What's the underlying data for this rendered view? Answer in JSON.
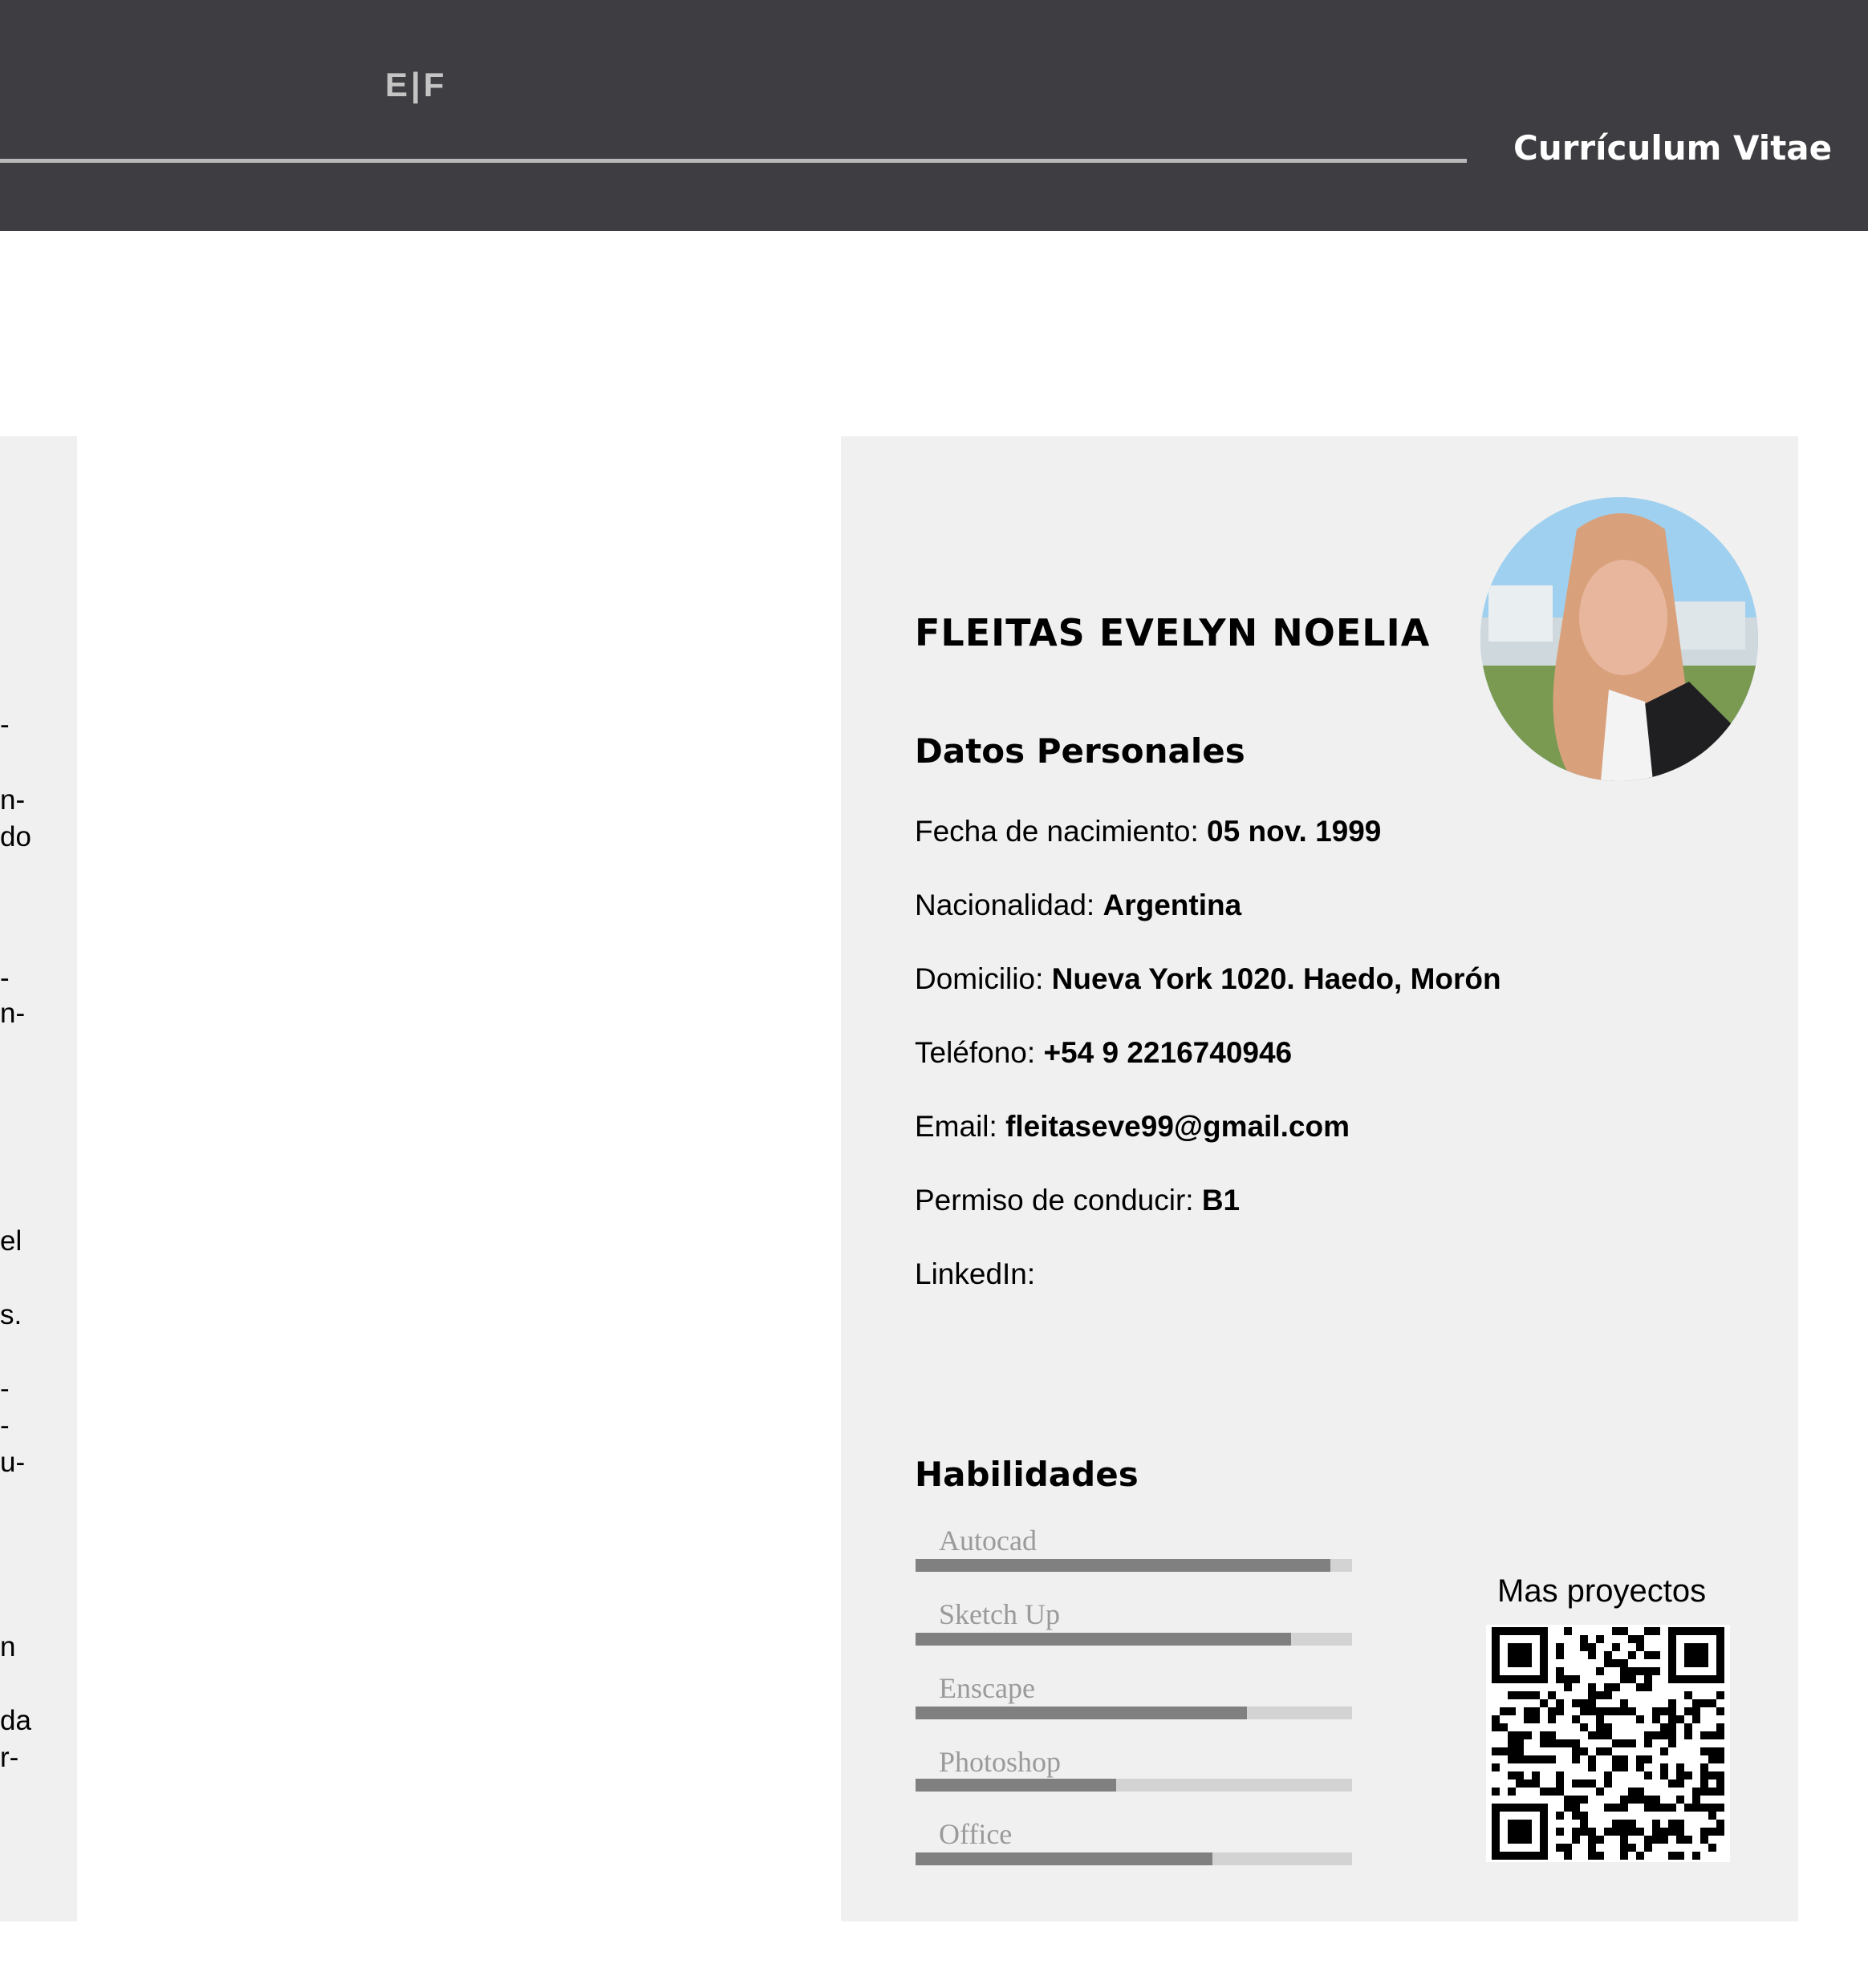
{
  "header": {
    "logo": "E|F",
    "title": "Currículum Vitae",
    "bg_color": "#3e3d41"
  },
  "left_fragments": [
    "-",
    "n-",
    "do",
    "-",
    "n-",
    "el",
    "s.",
    "-",
    "-",
    "u-",
    "n",
    "da",
    "r-"
  ],
  "profile": {
    "name": "FLEITAS EVELYN NOELIA",
    "photo": "profile-photo"
  },
  "personal": {
    "title": "Datos Personales",
    "fields": [
      {
        "label": "Fecha de nacimiento: ",
        "value": "05 nov. 1999"
      },
      {
        "label": "Nacionalidad: ",
        "value": "Argentina"
      },
      {
        "label": "Domicilio: ",
        "value": "Nueva York 1020. Haedo, Morón"
      },
      {
        "label": "Teléfono: ",
        "value": "+54 9 2216740946"
      },
      {
        "label": "Email: ",
        "value": "fleitaseve99@gmail.com"
      },
      {
        "label": "Permiso de conducir: ",
        "value": "B1"
      },
      {
        "label": "LinkedIn:",
        "value": ""
      }
    ]
  },
  "skills": {
    "title": "Habilidades",
    "items": [
      {
        "name": "Autocad",
        "level": 0.95
      },
      {
        "name": "Sketch Up",
        "level": 0.86
      },
      {
        "name": "Enscape",
        "level": 0.76
      },
      {
        "name": "Photoshop",
        "level": 0.46
      },
      {
        "name": "Office",
        "level": 0.68
      }
    ]
  },
  "projects": {
    "label": "Mas proyectos",
    "qr": "qr-code"
  }
}
